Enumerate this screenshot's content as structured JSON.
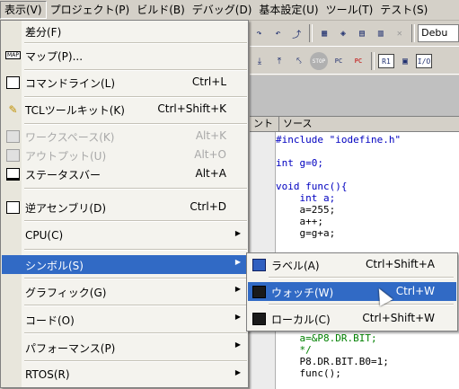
{
  "menubar": {
    "items": [
      {
        "label": "表示(V)"
      },
      {
        "label": "プロジェクト(P)"
      },
      {
        "label": "ビルド(B)"
      },
      {
        "label": "デバッグ(D)"
      },
      {
        "label": "基本設定(U)"
      },
      {
        "label": "ツール(T)"
      },
      {
        "label": "テスト(S)"
      }
    ]
  },
  "toolbar": {
    "debug_combo": "Debu",
    "stop_label": "STOP",
    "r1_label": "R1",
    "io_label": "I/O",
    "pc_label": "PC"
  },
  "editor": {
    "columns": [
      "ント",
      "ソース"
    ],
    "code_lines": [
      "#include \"iodefine.h\"",
      "",
      "int g=0;",
      "",
      "void func(){",
      "    int a;",
      "    a=255;",
      "    a++;",
      "    g=g+a;",
      "",
      "",
      "",
      "",
      "",
      "",
      "",
      "",
      "    a=&P8.DR.BIT;",
      "    */",
      "    P8.DR.BIT.B0=1;",
      "    func();"
    ]
  },
  "view_menu": {
    "items": [
      {
        "label": "差分(F)",
        "shortcut": "",
        "icon": "none",
        "disabled": false
      },
      {
        "label": "マップ(P)...",
        "shortcut": "",
        "icon": "map-icon",
        "disabled": false
      },
      {
        "label": "コマンドライン(L)",
        "shortcut": "Ctrl+L",
        "icon": "command-line-icon",
        "disabled": false
      },
      {
        "label": "TCLツールキット(K)",
        "shortcut": "Ctrl+Shift+K",
        "icon": "tcl-toolkit-icon",
        "disabled": false
      },
      {
        "label": "ワークスペース(K)",
        "shortcut": "Alt+K",
        "icon": "workspace-icon",
        "disabled": true
      },
      {
        "label": "アウトプット(U)",
        "shortcut": "Alt+O",
        "icon": "output-icon",
        "disabled": true
      },
      {
        "label": "ステータスバー",
        "shortcut": "Alt+A",
        "icon": "status-bar-icon",
        "disabled": false
      },
      {
        "label": "逆アセンブリ(D)",
        "shortcut": "Ctrl+D",
        "icon": "disassembly-icon",
        "disabled": false
      },
      {
        "label": "CPU(C)",
        "shortcut": "",
        "icon": "none",
        "disabled": false
      },
      {
        "label": "シンボル(S)",
        "shortcut": "",
        "icon": "none",
        "disabled": false
      },
      {
        "label": "グラフィック(G)",
        "shortcut": "",
        "icon": "none",
        "disabled": false
      },
      {
        "label": "コード(O)",
        "shortcut": "",
        "icon": "none",
        "disabled": false
      },
      {
        "label": "パフォーマンス(P)",
        "shortcut": "",
        "icon": "none",
        "disabled": false
      },
      {
        "label": "RTOS(R)",
        "shortcut": "",
        "icon": "none",
        "disabled": false
      }
    ]
  },
  "symbol_submenu": {
    "items": [
      {
        "label": "ラベル(A)",
        "shortcut": "Ctrl+Shift+A",
        "icon": "label-icon"
      },
      {
        "label": "ウォッチ(W)",
        "shortcut": "Ctrl+W",
        "icon": "watch-icon"
      },
      {
        "label": "ローカル(C)",
        "shortcut": "Ctrl+Shift+W",
        "icon": "local-icon"
      }
    ]
  }
}
